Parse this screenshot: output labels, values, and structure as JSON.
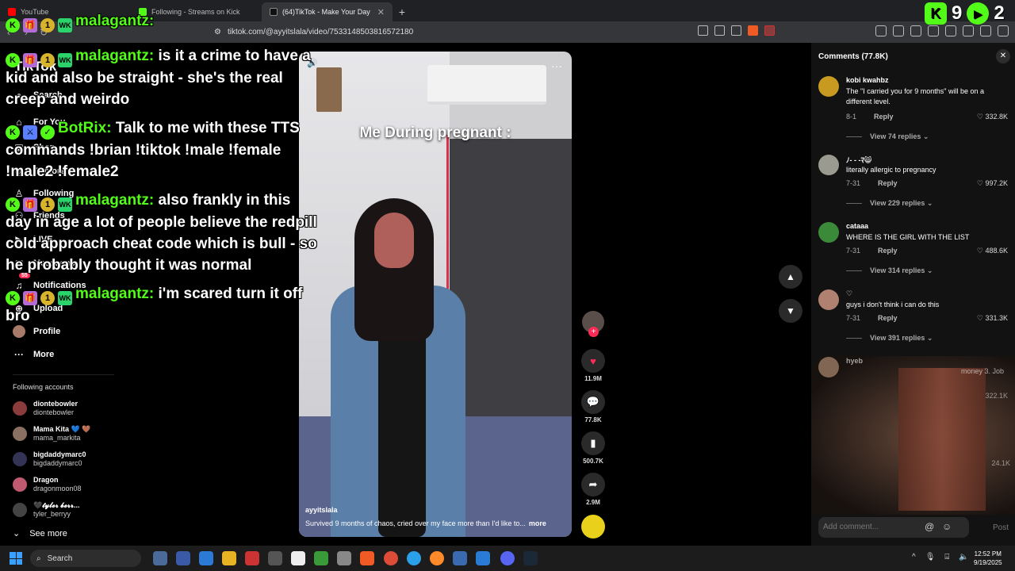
{
  "browser": {
    "tabs": [
      {
        "label": "YouTube",
        "active": false
      },
      {
        "label": "Following - Streams on Kick",
        "active": false
      },
      {
        "label": "(64)TikTok - Make Your Day",
        "active": true
      }
    ],
    "url": "tiktok.com/@ayyitslala/video/7533148503816572180"
  },
  "kick_overlay": {
    "count_left": "9",
    "count_right": "2"
  },
  "chat": {
    "top_user": "malagantz:",
    "messages": [
      {
        "user": "malagantz:",
        "text": "is it a crime to have a kid and also be straight - she's the real creep and weirdo"
      },
      {
        "user": "BotRix:",
        "text": "Talk to me with these TTS commands !brian !tiktok !male !female !male2 !female2"
      },
      {
        "user": "malagantz:",
        "text": "also frankly in this day in age a lot of people believe the redpill cold approach cheat code which is bull - so he probably thought it was normal"
      },
      {
        "user": "malagantz:",
        "text": "i'm scared turn it off bro"
      }
    ]
  },
  "sidebar": {
    "logo": "TikTok",
    "items": [
      {
        "label": "Search",
        "icon": "search-icon"
      },
      {
        "label": "For You",
        "icon": "home-icon"
      },
      {
        "label": "Shop",
        "icon": "shop-icon"
      },
      {
        "label": "Explore",
        "icon": "compass-icon"
      },
      {
        "label": "Following",
        "icon": "user-icon"
      },
      {
        "label": "Friends",
        "icon": "friends-icon"
      },
      {
        "label": "LIVE",
        "icon": "live-icon"
      },
      {
        "label": "Messages",
        "icon": "message-icon"
      },
      {
        "label": "Notifications",
        "icon": "bell-icon",
        "badge": "55"
      },
      {
        "label": "Upload",
        "icon": "upload-icon"
      },
      {
        "label": "Profile",
        "icon": "avatar"
      },
      {
        "label": "More",
        "icon": "more-icon"
      }
    ],
    "following_title": "Following accounts",
    "following": [
      {
        "name": "diontebowler",
        "user": "diontebowler",
        "color": "#8a3b3b"
      },
      {
        "name": "Mama Kita 💙 🤎",
        "user": "mama_markita",
        "color": "#8a7060"
      },
      {
        "name": "bigdaddymarc0",
        "user": "bigdaddymarc0",
        "color": "#333355"
      },
      {
        "name": "Dragon",
        "user": "dragonmoon08",
        "color": "#c05a70"
      },
      {
        "name": "🖤𝓽𝔂𝓵𝓮𝓻 𝓫𝓮𝓻𝓻...",
        "user": "tyler_berryy",
        "color": "#444444"
      }
    ],
    "see_more": "See more"
  },
  "video": {
    "overlay_text": "Me During pregnant :",
    "username": "ayyitslala",
    "caption": "Survived 9 months of chaos, cried over my face more than I'd like to...",
    "caption_more": "more"
  },
  "actions": {
    "likes": "11.9M",
    "comments": "77.8K",
    "saves": "500.7K",
    "shares": "2.9M"
  },
  "comments": {
    "title": "Comments (77.8K)",
    "items": [
      {
        "user": "kobi kwahbz",
        "text": "The \"I carried you for 9 months\" will be on a different level.",
        "date": "8-1",
        "reply": "Reply",
        "likes": "332.8K",
        "replies": "View 74 replies",
        "color": "#c89a20"
      },
      {
        "user": "ﾉ- - -ﾏ😸",
        "text": "literally allergic to pregnancy",
        "date": "7-31",
        "reply": "Reply",
        "likes": "997.2K",
        "replies": "View 229 replies",
        "color": "#9a9a90"
      },
      {
        "user": "cataaa",
        "text": "WHERE IS THE GIRL WITH THE LIST",
        "date": "7-31",
        "reply": "Reply",
        "likes": "488.6K",
        "replies": "View 314 replies",
        "color": "#3a8a3a"
      },
      {
        "user": "♡",
        "text": "guys i don't think i can do this",
        "date": "7-31",
        "reply": "Reply",
        "likes": "331.3K",
        "replies": "View 391 replies",
        "color": "#b08070"
      },
      {
        "user": "hyeb",
        "text": "money 3. Job",
        "date": "",
        "reply": "",
        "likes": "322.1K",
        "replies": "",
        "color": "#c8a080"
      }
    ],
    "extra_likes": "24.1K",
    "input_placeholder": "Add comment...",
    "post_label": "Post"
  },
  "taskbar": {
    "search_label": "Search",
    "time": "12:52 PM",
    "date": "9/19/2025"
  }
}
